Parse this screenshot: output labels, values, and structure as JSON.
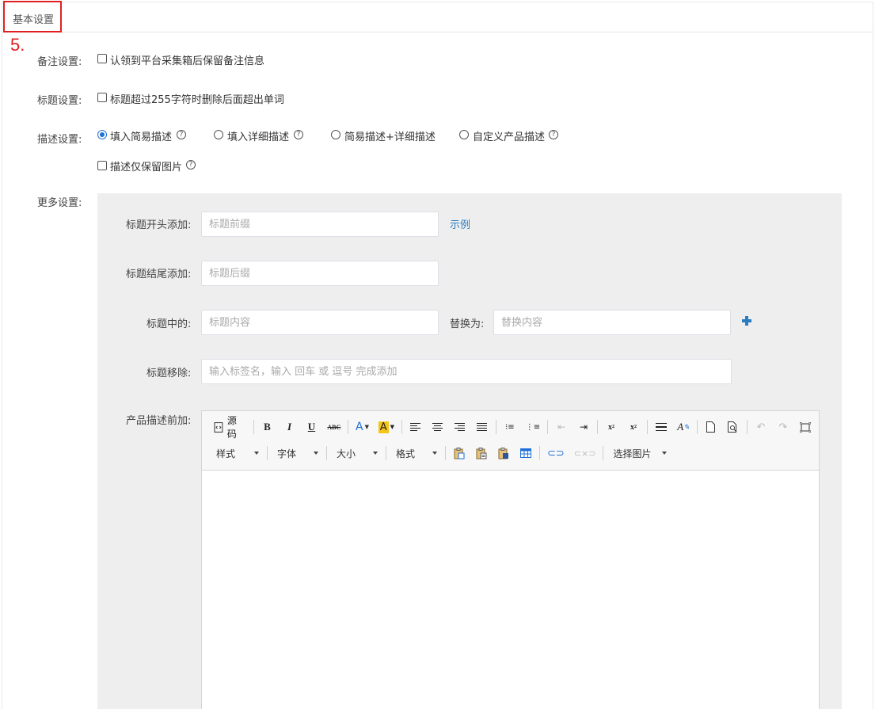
{
  "header": {
    "title": "基本设置",
    "step_marker": "5."
  },
  "remark": {
    "label": "备注设置:",
    "option": "认领到平台采集箱后保留备注信息",
    "checked": false
  },
  "title_setting": {
    "label": "标题设置:",
    "option": "标题超过255字符时删除后面超出单词",
    "checked": false
  },
  "description": {
    "label": "描述设置:",
    "options": [
      {
        "text": "填入简易描述",
        "selected": true,
        "help": true
      },
      {
        "text": "填入详细描述",
        "selected": false,
        "help": true
      },
      {
        "text": "简易描述+详细描述",
        "selected": false,
        "help": false
      },
      {
        "text": "自定义产品描述",
        "selected": false,
        "help": true
      }
    ],
    "images_only": {
      "text": "描述仅保留图片",
      "checked": false
    }
  },
  "more": {
    "label": "更多设置:",
    "prefix": {
      "label": "标题开头添加:",
      "placeholder": "标题前缀",
      "example_link": "示例"
    },
    "suffix": {
      "label": "标题结尾添加:",
      "placeholder": "标题后缀"
    },
    "replace": {
      "label": "标题中的:",
      "placeholder": "标题内容",
      "with_label": "替换为:",
      "with_placeholder": "替换内容"
    },
    "remove": {
      "label": "标题移除:",
      "placeholder": "输入标签名，输入 回车 或 逗号 完成添加"
    },
    "desc_prefix": {
      "label": "产品描述前加:"
    }
  },
  "editor": {
    "source_label": "源码",
    "dropdowns": {
      "style": "样式",
      "font": "字体",
      "size": "大小",
      "format": "格式",
      "image": "选择图片"
    },
    "icons": [
      "source-icon",
      "bold-icon",
      "italic-icon",
      "underline-icon",
      "strikethrough-icon",
      "font-color-icon",
      "highlight-color-icon",
      "align-left-icon",
      "align-center-icon",
      "align-right-icon",
      "align-justify-icon",
      "bulleted-list-icon",
      "numbered-list-icon",
      "outdent-icon",
      "indent-icon",
      "subscript-icon",
      "superscript-icon",
      "horizontal-rule-icon",
      "remove-format-icon",
      "new-page-icon",
      "preview-icon",
      "undo-icon",
      "redo-icon",
      "maximize-icon",
      "paste-icon",
      "paste-text-icon",
      "paste-word-icon",
      "table-icon",
      "link-icon",
      "unlink-icon"
    ],
    "colors": {
      "accent": "#2d7cc0",
      "highlight": "#f5c518",
      "font_color": "#1e6fd9",
      "marker": "#e02020"
    }
  }
}
